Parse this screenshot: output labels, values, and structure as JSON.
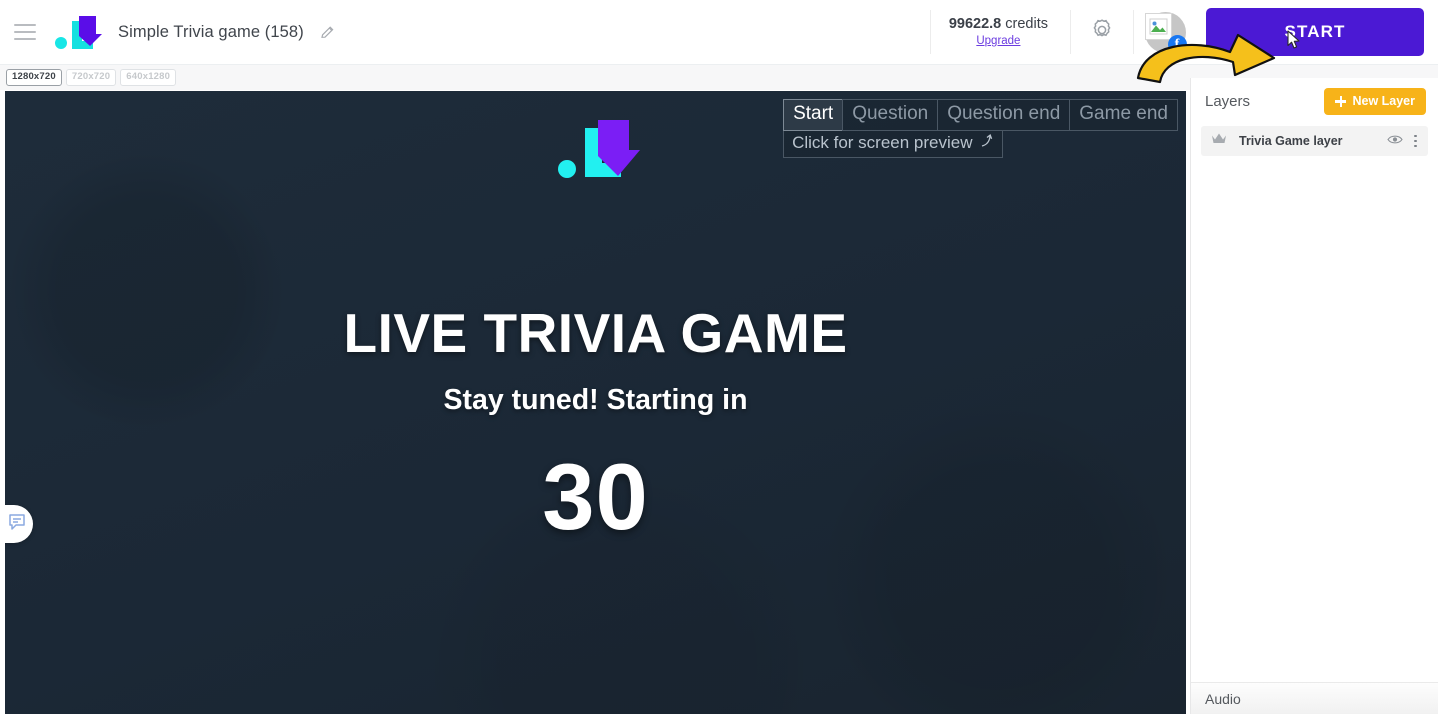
{
  "topbar": {
    "menu_icon": "hamburger-menu-icon",
    "logo_icon": "brand-logo-icon",
    "project_title": "Simple Trivia game (158)",
    "edit_icon": "pencil-edit-icon",
    "credits_amount": "99622.8",
    "credits_word": "credits",
    "upgrade_label": "Upgrade",
    "settings_icon": "gear-icon",
    "avatar_icon": "avatar-broken-image-icon",
    "avatar_badge": "f",
    "start_label": "START",
    "start_color": "#4b19d4",
    "annotation_arrow": "yellow-curved-arrow",
    "cursor": "mouse-pointer"
  },
  "resolution_toolbar": {
    "options": [
      {
        "label": "1280x720",
        "active": true
      },
      {
        "label": "720x720",
        "active": false
      },
      {
        "label": "640x1280",
        "active": false
      }
    ]
  },
  "canvas": {
    "background_color": "#1b2836",
    "logo_icon": "brand-logo-icon",
    "title": "LIVE TRIVIA GAME",
    "subtitle": "Stay tuned! Starting in",
    "countdown": "30",
    "preview_tabs": [
      {
        "label": "Start",
        "active": true
      },
      {
        "label": "Question",
        "active": false
      },
      {
        "label": "Question end",
        "active": false
      },
      {
        "label": "Game end",
        "active": false
      }
    ],
    "preview_hint": "Click for screen preview",
    "preview_hint_icon": "arrow-up-right-icon",
    "chat_icon": "chat-bubble-icon"
  },
  "right_panel": {
    "layers_title": "Layers",
    "new_layer_label": "New Layer",
    "new_layer_icon": "plus-icon",
    "new_layer_color": "#f7b319",
    "layers": [
      {
        "crown_icon": "crown-icon",
        "name": "Trivia Game layer",
        "visibility_icon": "eye-icon",
        "menu_icon": "more-vertical-icon"
      }
    ],
    "audio_label": "Audio"
  }
}
